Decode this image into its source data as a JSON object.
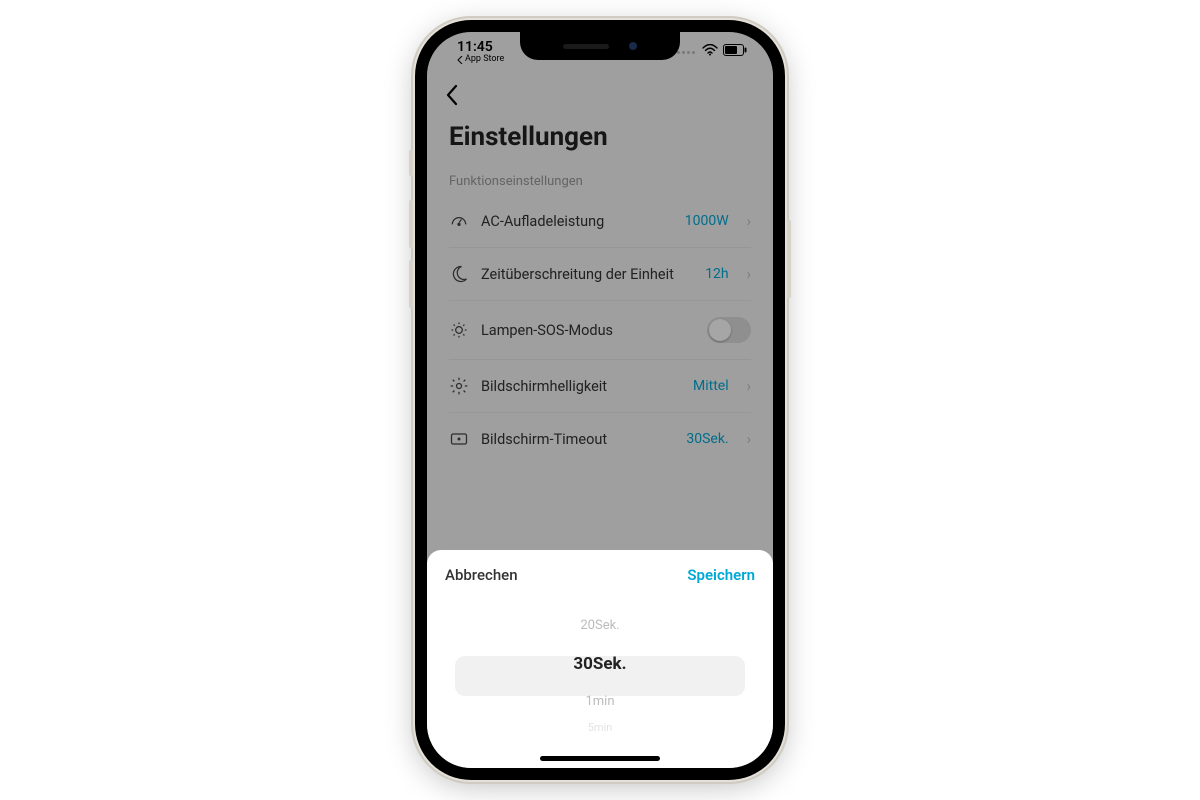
{
  "statusbar": {
    "time": "11:45",
    "back_app_label": "App Store"
  },
  "page": {
    "title": "Einstellungen",
    "section_label": "Funktionseinstellungen"
  },
  "rows": {
    "ac_charge": {
      "label": "AC-Aufladeleistung",
      "value": "1000W"
    },
    "unit_timeout": {
      "label": "Zeitüberschreitung der Einheit",
      "value": "12h"
    },
    "lamp_sos": {
      "label": "Lampen-SOS-Modus",
      "toggle": false
    },
    "brightness": {
      "label": "Bildschirmhelligkeit",
      "value": "Mittel"
    },
    "screen_to": {
      "label": "Bildschirm-Timeout",
      "value": "30Sek."
    }
  },
  "sheet": {
    "cancel": "Abbrechen",
    "save": "Speichern",
    "options": {
      "o0": "20Sek.",
      "o1": "30Sek.",
      "o2": "1min",
      "o3": "5min"
    },
    "selected_index": 1
  },
  "colors": {
    "accent": "#00a8d6"
  }
}
